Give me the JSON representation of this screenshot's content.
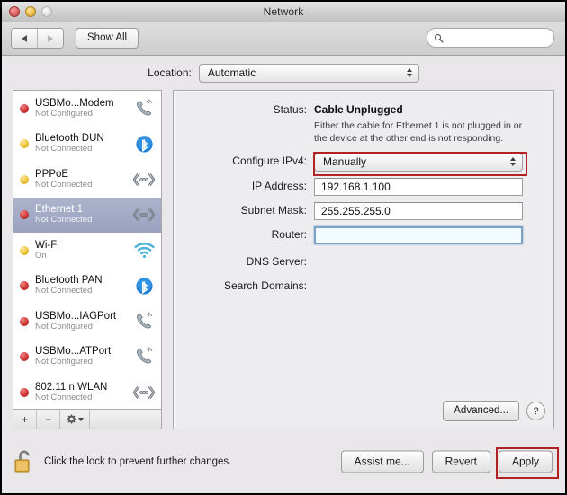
{
  "window": {
    "title": "Network",
    "traffic_lights": [
      "close",
      "minimize",
      "zoom"
    ]
  },
  "toolbar": {
    "back_icon": "back-arrow-icon",
    "forward_icon": "forward-arrow-icon",
    "show_all_label": "Show All",
    "search_icon": "search-icon",
    "search_value": "",
    "search_placeholder": ""
  },
  "location": {
    "label": "Location:",
    "selected": "Automatic"
  },
  "sidebar": {
    "items": [
      {
        "name": "USBMo...Modem",
        "state": "Not Configured",
        "dot": "red",
        "icon": "modem-phone-icon",
        "selected": false
      },
      {
        "name": "Bluetooth DUN",
        "state": "Not Connected",
        "dot": "yellow",
        "icon": "bluetooth-icon",
        "selected": false
      },
      {
        "name": "PPPoE",
        "state": "Not Connected",
        "dot": "yellow",
        "icon": "ethernet-icon",
        "selected": false
      },
      {
        "name": "Ethernet 1",
        "state": "Not Connected",
        "dot": "red",
        "icon": "ethernet-icon",
        "selected": true
      },
      {
        "name": "Wi-Fi",
        "state": "On",
        "dot": "yellow",
        "icon": "wifi-icon",
        "selected": false
      },
      {
        "name": "Bluetooth PAN",
        "state": "Not Connected",
        "dot": "red",
        "icon": "bluetooth-icon",
        "selected": false
      },
      {
        "name": "USBMo...IAGPort",
        "state": "Not Configured",
        "dot": "red",
        "icon": "modem-phone-icon",
        "selected": false
      },
      {
        "name": "USBMo...ATPort",
        "state": "Not Configured",
        "dot": "red",
        "icon": "modem-phone-icon",
        "selected": false
      },
      {
        "name": "802.11 n WLAN",
        "state": "Not Connected",
        "dot": "red",
        "icon": "ethernet-icon",
        "selected": false
      }
    ],
    "toolbar": {
      "add_label": "+",
      "remove_label": "−",
      "gear_icon": "gear-icon"
    }
  },
  "main": {
    "status_label": "Status:",
    "status_value": "Cable Unplugged",
    "status_description": "Either the cable for Ethernet 1 is not plugged in or the device at the other end is not responding.",
    "configure_ipv4_label": "Configure IPv4:",
    "configure_ipv4_value": "Manually",
    "ip_address_label": "IP Address:",
    "ip_address_value": "192.168.1.100",
    "subnet_mask_label": "Subnet Mask:",
    "subnet_mask_value": "255.255.255.0",
    "router_label": "Router:",
    "router_value": "",
    "dns_server_label": "DNS Server:",
    "dns_server_value": "",
    "search_domains_label": "Search Domains:",
    "search_domains_value": "",
    "advanced_label": "Advanced...",
    "help_label": "?"
  },
  "footer": {
    "lock_icon": "unlocked-padlock-icon",
    "lock_text": "Click the lock to prevent further changes.",
    "assist_label": "Assist me...",
    "revert_label": "Revert",
    "apply_label": "Apply"
  },
  "annotations": {
    "highlight_color": "#b22222",
    "highlighted": [
      "configure-ipv4-popup",
      "apply-button"
    ]
  }
}
